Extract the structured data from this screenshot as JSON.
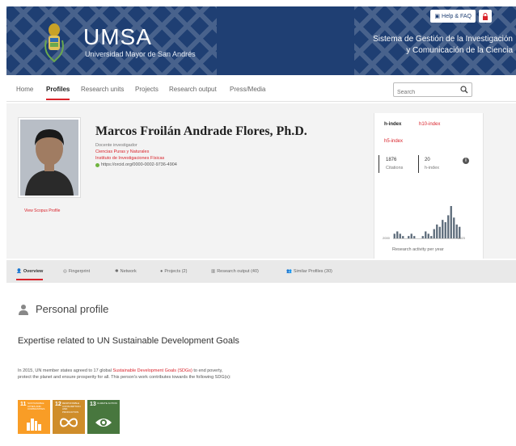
{
  "header": {
    "logo_title": "UMSA",
    "logo_subtitle": "Universidad Mayor de San Andrés",
    "help_label": "Help & FAQ",
    "system_title_line1": "Sistema de Gestión de la Investigación",
    "system_title_line2": "y Comunicación de la Ciencia",
    "bg_color": "#1f3f73"
  },
  "nav": {
    "items": [
      {
        "label": "Home"
      },
      {
        "label": "Profiles"
      },
      {
        "label": "Research units"
      },
      {
        "label": "Projects"
      },
      {
        "label": "Research output"
      },
      {
        "label": "Press/Media"
      }
    ],
    "active": "Profiles",
    "search_placeholder": "Search"
  },
  "profile": {
    "name": "Marcos Froilán Andrade Flores, Ph.D.",
    "role": "Docente investigador",
    "faculty": "Ciencias Puras y Naturales",
    "institute": "Instituto de Investigaciones Físicas",
    "orcid": "https://orcid.org/0000-0002-9736-4904",
    "scopus_link": "View Scopus Profile"
  },
  "metrics": {
    "tabs": [
      "h-index",
      "h10-index",
      "h5-index"
    ],
    "active_tab": "h-index",
    "citations_value": "1876",
    "citations_label": "Citations",
    "hindex_value": "20",
    "hindex_label": "h-index",
    "year_start": "2000",
    "year_end": "2023",
    "activity_label": "Research activity per year",
    "activity_bars": [
      2,
      3,
      2,
      1,
      0,
      1,
      2,
      1,
      0,
      0,
      1,
      3,
      2,
      1,
      4,
      6,
      5,
      8,
      7,
      10,
      14,
      9,
      6,
      5
    ]
  },
  "subtabs": [
    {
      "label": "Overview",
      "icon": "person-icon"
    },
    {
      "label": "Fingerprint",
      "icon": "fingerprint-icon"
    },
    {
      "label": "Network",
      "icon": "network-icon"
    },
    {
      "label": "Projects (2)",
      "icon": "projects-icon"
    },
    {
      "label": "Research output (40)",
      "icon": "output-icon"
    },
    {
      "label": "Similar Profiles (30)",
      "icon": "similar-icon"
    }
  ],
  "personal_profile": {
    "title": "Personal profile",
    "sdg_title": "Expertise related to UN Sustainable Development Goals",
    "sdg_text_before": "In 2015, UN member states agreed to 17 global ",
    "sdg_link": "Sustainable Development Goals (SDGs)",
    "sdg_text_after": " to end poverty, protect the planet and ensure prosperity for all. This person's work contributes towards the following SDG(s):",
    "goals": [
      {
        "num": "11",
        "label": "SUSTAINABLE CITIES AND COMMUNITIES",
        "color": "#f99d26"
      },
      {
        "num": "12",
        "label": "RESPONSIBLE CONSUMPTION AND PRODUCTION",
        "color": "#cf8d2a"
      },
      {
        "num": "13",
        "label": "CLIMATE ACTION",
        "color": "#48773e"
      }
    ]
  }
}
